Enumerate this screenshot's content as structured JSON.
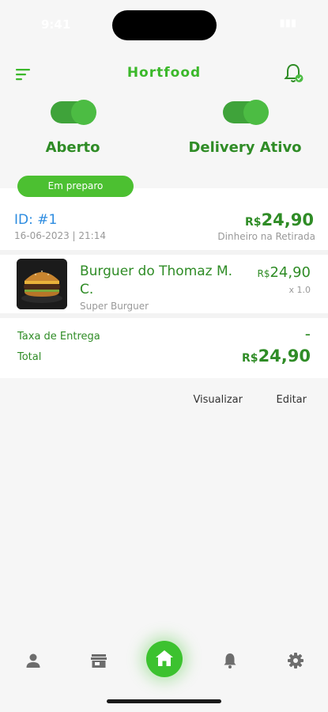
{
  "status_bar": {
    "time": "9:41",
    "indicators": "▮▮▮"
  },
  "header": {
    "title": "Hortfood",
    "menu_icon": "sort-menu-icon",
    "notification_icon": "bell-icon"
  },
  "toggles": [
    {
      "label": "Aberto",
      "on": true
    },
    {
      "label": "Delivery Ativo",
      "on": true
    }
  ],
  "order_status": "Em preparo",
  "order": {
    "id": "ID: #1",
    "date": "16-06-2023 | 21:14",
    "currency": "R$",
    "total": "24,90",
    "payment_method": "Dinheiro na Retirada",
    "items": [
      {
        "name": "Burguer do Thomaz M. C.",
        "category": "Super Burguer",
        "currency": "R$",
        "price": "24,90",
        "quantity": "x 1.0"
      }
    ],
    "delivery_fee_label": "Taxa de Entrega",
    "delivery_fee_value": "-",
    "total_label": "Total",
    "total_currency": "R$",
    "total_value": "24,90"
  },
  "actions": {
    "view": "Visualizar",
    "edit": "Editar"
  },
  "bottom_nav": [
    {
      "name": "profile",
      "icon": "person-icon",
      "active": false
    },
    {
      "name": "store",
      "icon": "store-icon",
      "active": false
    },
    {
      "name": "home",
      "icon": "home-icon",
      "active": true
    },
    {
      "name": "notifications",
      "icon": "bell-icon",
      "active": false
    },
    {
      "name": "settings",
      "icon": "gear-icon",
      "active": false
    }
  ],
  "colors": {
    "primary_green": "#3bb82a",
    "dark_green": "#2f8c26",
    "link_blue": "#2d8ce0",
    "muted": "#999999",
    "background": "#f6f6f6"
  }
}
